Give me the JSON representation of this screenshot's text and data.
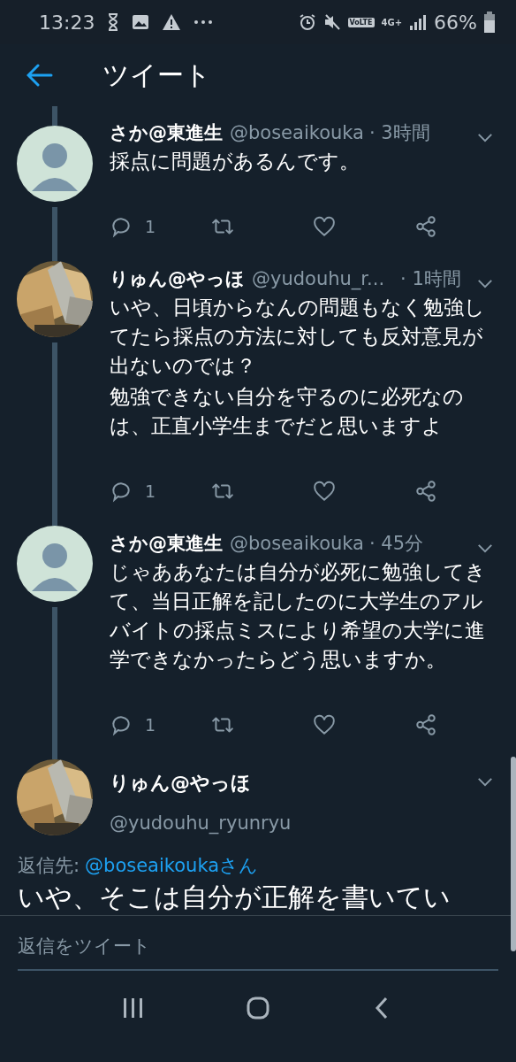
{
  "status_bar": {
    "time": "13:23",
    "volte": "VoLTE",
    "network": "4G+",
    "battery": "66%"
  },
  "header": {
    "title": "ツイート"
  },
  "tweets": [
    {
      "name": "さか@東進生",
      "handle": "@boseaikouka",
      "time": "· 3時間",
      "text": [
        "採点に問題があるんです。"
      ],
      "reply_count": "1",
      "avatar": {
        "kind": "silhouette"
      }
    },
    {
      "name": "りゅん@やっほ",
      "handle": "@yudouhu_r...",
      "time": "· 1時間",
      "text": [
        "いや、日頃からなんの問題もなく勉強してたら採点の方法に対しても反対意見が出ないのでは？",
        "勉強できない自分を守るのに必死なのは、正直小学生までだと思いますよ"
      ],
      "reply_count": "1",
      "avatar": {
        "kind": "picture"
      }
    },
    {
      "name": "さか@東進生",
      "handle": "@boseaikouka",
      "time": "· 45分",
      "text": [
        "じゃああなたは自分が必死に勉強してきて、当日正解を記したのに大学生のアルバイトの採点ミスにより希望の大学に進学できなかったらどう思いますか。"
      ],
      "reply_count": "1",
      "avatar": {
        "kind": "silhouette"
      }
    }
  ],
  "focused_tweet": {
    "name": "りゅん@やっほ",
    "handle": "@yudouhu_ryunryu",
    "reply_to_label": "返信先:",
    "reply_to": "@boseaikoukaさん",
    "text": "いや、そこは自分が正解を書いてい",
    "avatar": {
      "kind": "picture"
    }
  },
  "reply_bar": {
    "placeholder": "返信をツイート"
  }
}
